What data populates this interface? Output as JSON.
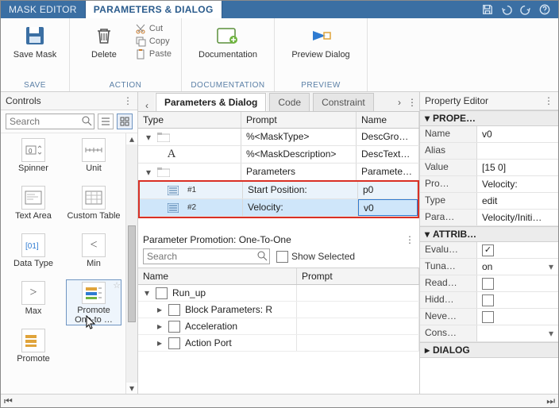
{
  "tabs": {
    "inactive": "MASK EDITOR",
    "active": "PARAMETERS & DIALOG"
  },
  "titleIcons": [
    "save-icon",
    "undo-icon",
    "redo-icon",
    "help-icon"
  ],
  "ribbon": {
    "save": {
      "label": "Save Mask",
      "group": "SAVE"
    },
    "action": {
      "delete": "Delete",
      "cut": "Cut",
      "copy": "Copy",
      "paste": "Paste",
      "group": "ACTION"
    },
    "doc": {
      "label": "Documentation",
      "group": "DOCUMENTATION"
    },
    "preview": {
      "label": "Preview Dialog",
      "group": "PREVIEW"
    }
  },
  "controls": {
    "title": "Controls",
    "searchPlaceholder": "Search",
    "items": [
      "Spinner",
      "Unit",
      "Text Area",
      "Custom Table",
      "Data Type",
      "Min",
      "Max",
      "Promote One-to …",
      "Promote"
    ]
  },
  "center": {
    "tabs": [
      "Parameters & Dialog",
      "Code",
      "Constraint"
    ],
    "columns": {
      "type": "Type",
      "prompt": "Prompt",
      "name": "Name"
    },
    "rows": {
      "r0": {
        "prompt": "%<MaskType>",
        "name": "DescGroupVar"
      },
      "r1": {
        "prompt": "%<MaskDescription>",
        "name": "DescTextVar"
      },
      "r2": {
        "prompt": "Parameters",
        "name": "ParameterGroupVar"
      },
      "r3": {
        "idx": "#1",
        "prompt": "Start Position:",
        "name": "p0"
      },
      "r4": {
        "idx": "#2",
        "prompt": "Velocity:",
        "name": "v0"
      }
    },
    "promotion": {
      "title": "Parameter Promotion: One-To-One",
      "searchPlaceholder": "Search",
      "showSelected": "Show Selected",
      "columns": {
        "name": "Name",
        "prompt": "Prompt"
      },
      "tree": {
        "root": "Run_up",
        "n1": "Block Parameters: R",
        "n2": "Acceleration",
        "n3": "Action Port"
      }
    }
  },
  "prop": {
    "title": "Property Editor",
    "sections": {
      "properties": "PROPE…",
      "attributes": "ATTRIB…",
      "dialog": "DIALOG"
    },
    "rows": {
      "name": {
        "k": "Name",
        "v": "v0"
      },
      "alias": {
        "k": "Alias",
        "v": ""
      },
      "value": {
        "k": "Value",
        "v": "[15 0]"
      },
      "prompt": {
        "k": "Pro…",
        "v": "Velocity:"
      },
      "type": {
        "k": "Type",
        "v": "edit"
      },
      "param": {
        "k": "Para…",
        "v": "Velocity/Initi…"
      },
      "eval": {
        "k": "Evalu…",
        "checked": true
      },
      "tuna": {
        "k": "Tuna…",
        "v": "on"
      },
      "read": {
        "k": "Read…",
        "checked": false
      },
      "hidd": {
        "k": "Hidd…",
        "checked": false
      },
      "neve": {
        "k": "Neve…",
        "checked": false
      },
      "cons": {
        "k": "Cons…",
        "v": ""
      }
    }
  }
}
